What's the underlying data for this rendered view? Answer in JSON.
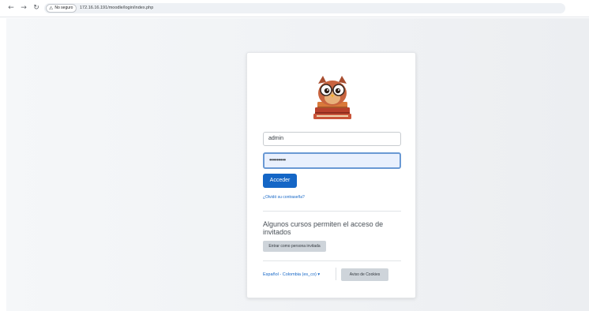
{
  "browser": {
    "security_label": "No seguro",
    "url": "172.16.16.191/moodle/login/index.php"
  },
  "login": {
    "username_value": "admin",
    "password_value": "•••••••••",
    "submit_label": "Acceder",
    "forgot_link": "¿Olvidó su contraseña?"
  },
  "guest": {
    "message": "Algunos cursos permiten el acceso de invitados",
    "button_label": "Entrar como persona invitada"
  },
  "footer": {
    "language": "Español - Colombia (es_co) ▾",
    "cookie_notice_label": "Aviso de Cookies"
  },
  "icons": {
    "back": "arrow-left-icon",
    "forward": "arrow-right-icon",
    "reload": "reload-icon",
    "warning": "warning-triangle-icon",
    "logo": "owl-books-logo"
  },
  "colors": {
    "primary": "#1466c6",
    "secondary_button": "#ced4da",
    "password_focus_bg": "#e9f0fd"
  }
}
